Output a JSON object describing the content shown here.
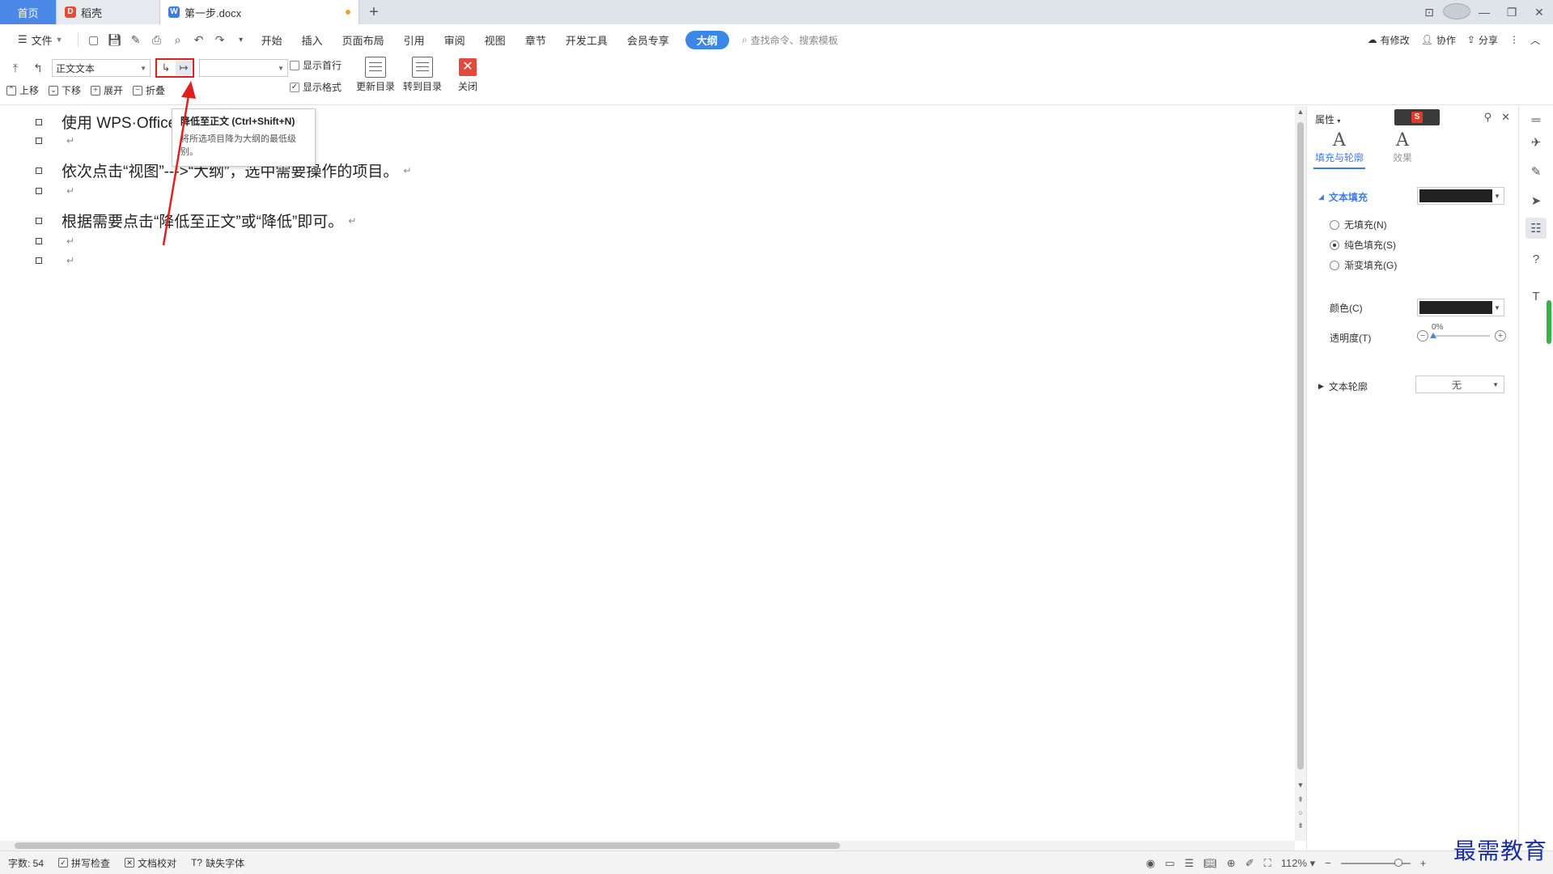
{
  "tabs": {
    "home": "首页",
    "daoke": "稻壳",
    "doc": "第一步.docx",
    "add": "+"
  },
  "menu": {
    "file": "文件",
    "items": [
      "开始",
      "插入",
      "页面布局",
      "引用",
      "审阅",
      "视图",
      "章节",
      "开发工具",
      "会员专享"
    ],
    "active": "大纲",
    "search_placeholder": "查找命令、搜索模板",
    "has_changes": "有修改",
    "collab": "协作",
    "share": "分享"
  },
  "outline_toolbar": {
    "level_value": "正文文本",
    "show_first_line": "显示首行",
    "show_format": "显示格式",
    "move_up": "上移",
    "move_down": "下移",
    "expand": "展开",
    "collapse": "折叠",
    "update_toc": "更新目录",
    "goto_toc": "转到目录",
    "close": "关闭"
  },
  "tooltip": {
    "title": "降低至正文 (Ctrl+Shift+N)",
    "desc": "将所选项目降为大纲的最低级别。"
  },
  "document": {
    "lines": [
      "使用 WPS·Office",
      "",
      "依次点击“视图”--->“大纲”，选中需要操作的项目。",
      "",
      "根据需要点击“降低至正文”或“降低”即可。",
      "",
      ""
    ],
    "para_mark": "↵"
  },
  "panel": {
    "title": "属性",
    "tab_fill": "填充与轮廓",
    "tab_effect": "效果",
    "text_fill": "文本填充",
    "no_fill": "无填充(N)",
    "solid_fill": "纯色填充(S)",
    "gradient_fill": "渐变填充(G)",
    "color": "颜色(C)",
    "transparency": "透明度(T)",
    "transparency_value": "0%",
    "text_outline": "文本轮廓",
    "outline_value": "无",
    "fill_color": "#222222",
    "selected_fill": "solid"
  },
  "status": {
    "word_count": "字数: 54",
    "spell_check": "拼写检查",
    "doc_proof": "文档校对",
    "missing_font": "缺失字体",
    "zoom": "112%"
  },
  "watermark": "最需教育",
  "colors": {
    "accent": "#3b86e6",
    "annotation_red": "#e02020"
  }
}
